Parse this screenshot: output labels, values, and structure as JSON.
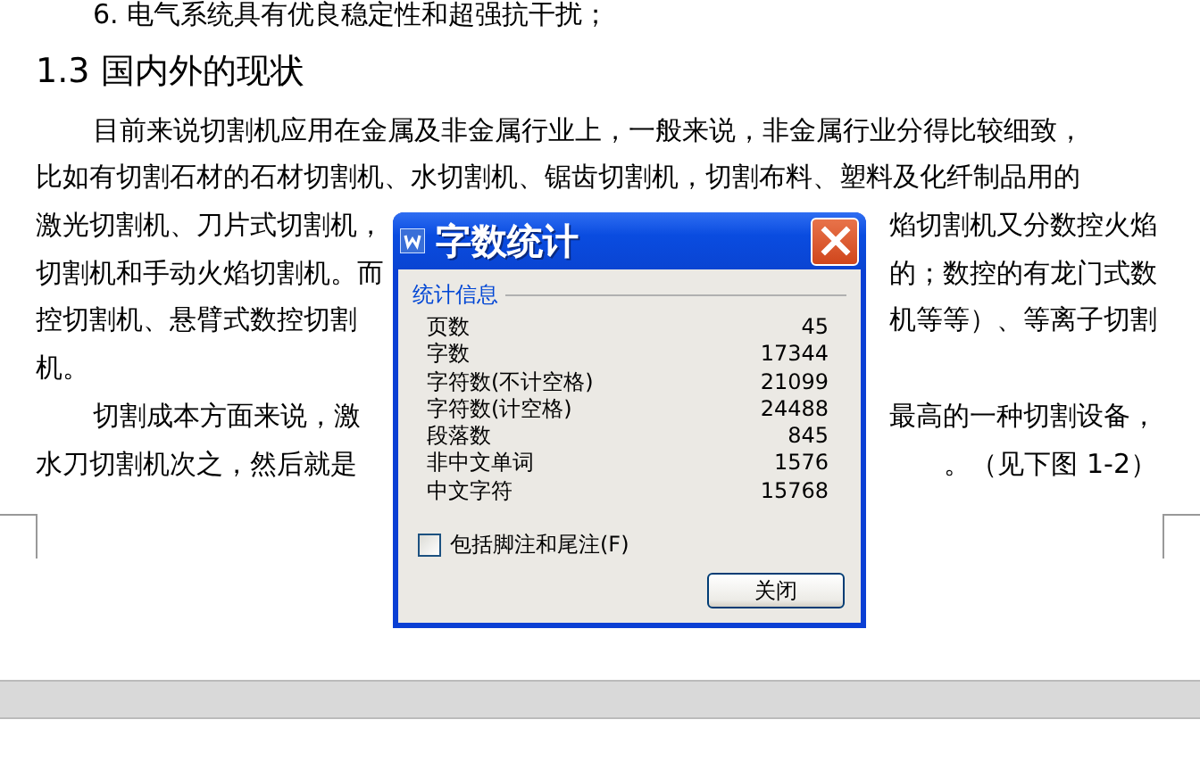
{
  "document": {
    "lines": [
      {
        "kind": "list-item",
        "text": "6. 电气系统具有优良稳定性和超强抗干扰；"
      },
      {
        "kind": "heading",
        "text": "1.3 国内外的现状"
      },
      {
        "kind": "body-start",
        "text": "目前来说切割机应用在金属及非金属行业上，一般来说，非金属行业分得比较细致，"
      },
      {
        "kind": "body",
        "text": "比如有切割石材的石材切割机、水切割机、锯齿切割机，切割布料、塑料及化纤制品用的"
      },
      {
        "kind": "split",
        "left": "激光切割机、刀片式切割机，",
        "right": "焰切割机又分数控火焰"
      },
      {
        "kind": "split",
        "left": "切割机和手动火焰切割机。而",
        "right": "的；数控的有龙门式数"
      },
      {
        "kind": "split",
        "left": "控切割机、悬臂式数控切割",
        "right": "机等等）、等离子切割"
      },
      {
        "kind": "body",
        "text": "机。"
      },
      {
        "kind": "split-start",
        "left": "切割成本方面来说，激",
        "right": "最高的一种切割设备，"
      },
      {
        "kind": "split",
        "left": "水刀切割机次之，然后就是",
        "right": "。（见下图 1-2）"
      }
    ]
  },
  "dialog": {
    "title": "字数统计",
    "group_label": "统计信息",
    "stats": [
      {
        "label": "页数",
        "value": "45"
      },
      {
        "label": "字数",
        "value": "17344"
      },
      {
        "label": "字符数(不计空格)",
        "value": "21099"
      },
      {
        "label": "字符数(计空格)",
        "value": "24488"
      },
      {
        "label": "段落数",
        "value": "845"
      },
      {
        "label": "非中文单词",
        "value": "1576"
      },
      {
        "label": "中文字符",
        "value": "15768"
      }
    ],
    "checkbox": {
      "label": "包括脚注和尾注(F)",
      "checked": false
    },
    "buttons": [
      "关闭"
    ]
  }
}
